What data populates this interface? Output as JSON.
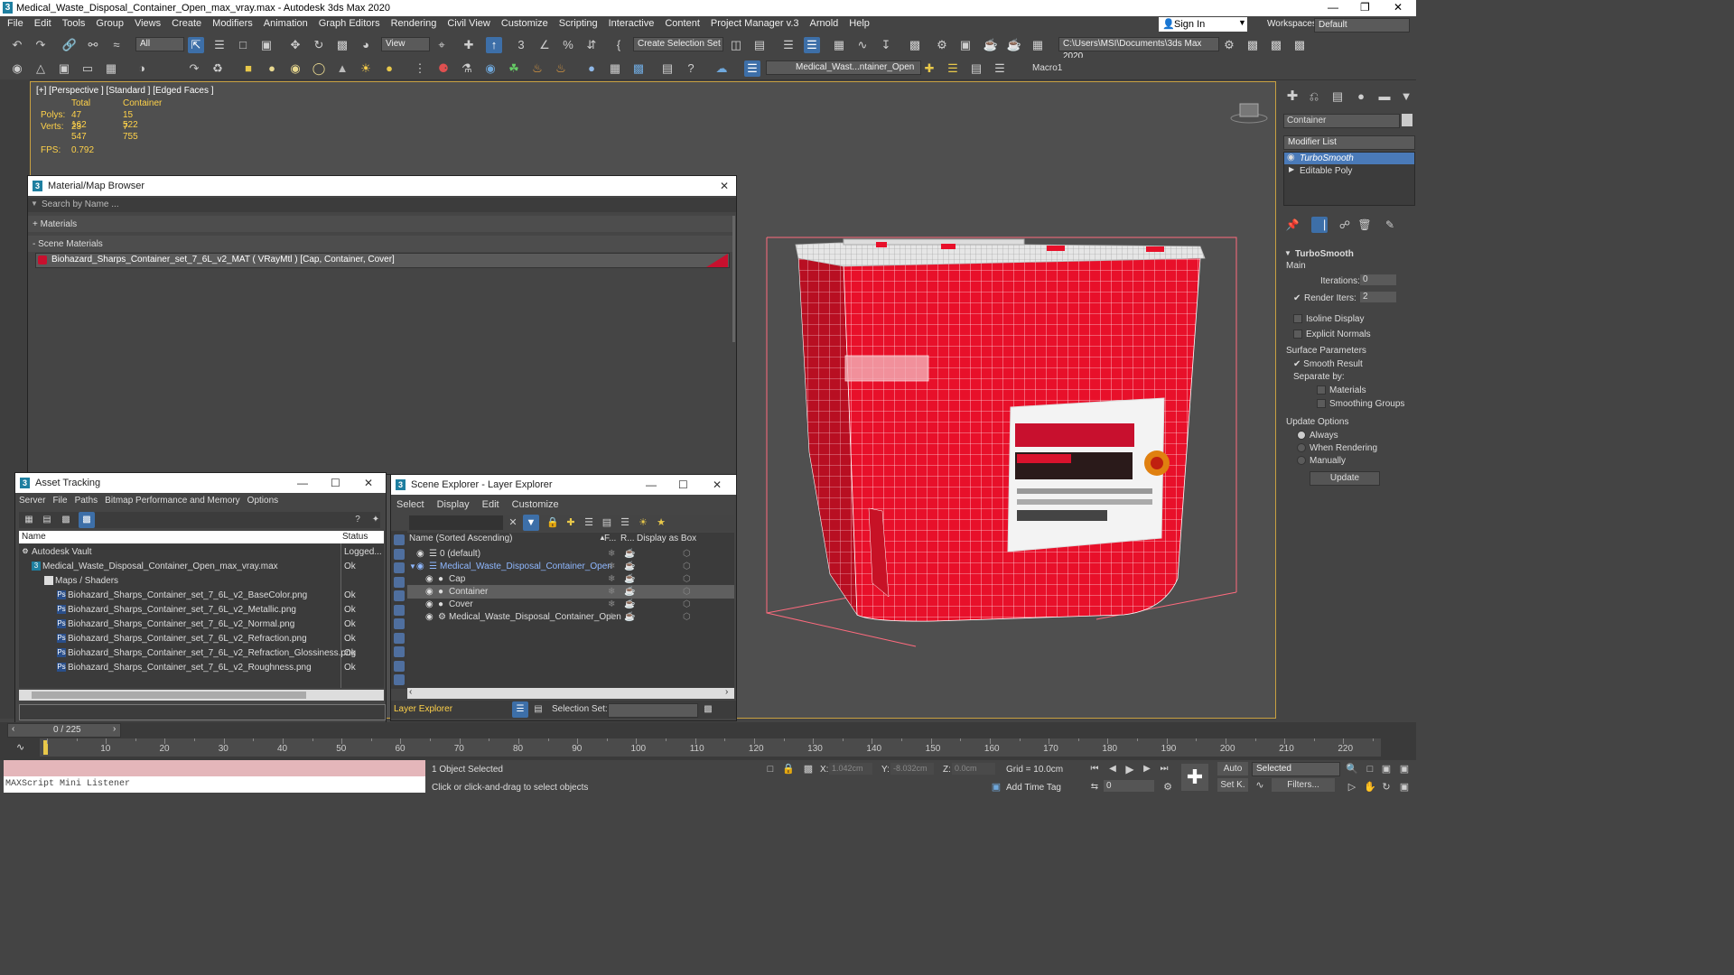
{
  "window": {
    "title": "Medical_Waste_Disposal_Container_Open_max_vray.max - Autodesk 3ds Max 2020"
  },
  "menu": [
    "File",
    "Edit",
    "Tools",
    "Group",
    "Views",
    "Create",
    "Modifiers",
    "Animation",
    "Graph Editors",
    "Rendering",
    "Civil View",
    "Customize",
    "Scripting",
    "Interactive",
    "Content",
    "Project Manager v.3",
    "Arnold",
    "Help"
  ],
  "account": {
    "sign_in": "Sign In",
    "workspaces_label": "Workspaces:",
    "workspace": "Default"
  },
  "toolbar": {
    "filter": "All",
    "view": "View",
    "selection_set": "Create Selection Set",
    "path": "C:\\Users\\MSI\\Documents\\3ds Max 2020",
    "layer": "Medical_Wast...ntainer_Open",
    "macro": "Macro1"
  },
  "viewport": {
    "label": "[+] [Perspective ] [Standard ] [Edged Faces ]",
    "stats": {
      "col_total": "Total",
      "col_container": "Container",
      "polys_label": "Polys:",
      "polys_total": "47 162",
      "polys_container": "15 522",
      "verts_label": "Verts:",
      "verts_total": "23 547",
      "verts_container": "7 755",
      "fps_label": "FPS:",
      "fps": "0.792"
    }
  },
  "material_browser": {
    "title": "Material/Map Browser",
    "search_placeholder": "Search by Name ...",
    "materials_group": "+ Materials",
    "scene_group": "- Scene Materials",
    "item": "Biohazard_Sharps_Container_set_7_6L_v2_MAT  ( VRayMtl )  [Cap, Container, Cover]"
  },
  "asset_tracking": {
    "title": "Asset Tracking",
    "menu": [
      "Server",
      "File",
      "Paths",
      "Bitmap Performance and Memory",
      "Options"
    ],
    "col_name": "Name",
    "col_status": "Status",
    "rows": [
      {
        "name": "Autodesk Vault",
        "status": "Logged..."
      },
      {
        "name": "Medical_Waste_Disposal_Container_Open_max_vray.max",
        "status": "Ok"
      },
      {
        "name": "Maps / Shaders",
        "status": ""
      },
      {
        "name": "Biohazard_Sharps_Container_set_7_6L_v2_BaseColor.png",
        "status": "Ok"
      },
      {
        "name": "Biohazard_Sharps_Container_set_7_6L_v2_Metallic.png",
        "status": "Ok"
      },
      {
        "name": "Biohazard_Sharps_Container_set_7_6L_v2_Normal.png",
        "status": "Ok"
      },
      {
        "name": "Biohazard_Sharps_Container_set_7_6L_v2_Refraction.png",
        "status": "Ok"
      },
      {
        "name": "Biohazard_Sharps_Container_set_7_6L_v2_Refraction_Glossiness.png",
        "status": "Ok"
      },
      {
        "name": "Biohazard_Sharps_Container_set_7_6L_v2_Roughness.png",
        "status": "Ok"
      }
    ]
  },
  "scene_explorer": {
    "title": "Scene Explorer - Layer Explorer",
    "menu": [
      "Select",
      "Display",
      "Edit",
      "Customize"
    ],
    "col_name": "Name (Sorted Ascending)",
    "col_f": "F...",
    "col_r": "R...",
    "col_box": "Display as Box",
    "rows": [
      {
        "name": "0 (default)"
      },
      {
        "name": "Medical_Waste_Disposal_Container_Open"
      },
      {
        "name": "Cap"
      },
      {
        "name": "Container"
      },
      {
        "name": "Cover"
      },
      {
        "name": "Medical_Waste_Disposal_Container_Open"
      }
    ],
    "footer_label": "Layer Explorer",
    "selection_set_label": "Selection Set:"
  },
  "command_panel": {
    "object_name": "Container",
    "modifier_list": "Modifier List",
    "stack": [
      "TurboSmooth",
      "Editable Poly"
    ],
    "rollout_title": "TurboSmooth",
    "main": "Main",
    "iterations_label": "Iterations:",
    "iterations": "0",
    "render_iters_label": "Render Iters:",
    "render_iters": "2",
    "isoline": "Isoline Display",
    "explicit": "Explicit Normals",
    "surface": "Surface Parameters",
    "smooth_result": "Smooth Result",
    "separate": "Separate by:",
    "sep_materials": "Materials",
    "sep_smoothing": "Smoothing Groups",
    "update_options": "Update Options",
    "always": "Always",
    "when_rendering": "When Rendering",
    "manually": "Manually",
    "update_btn": "Update"
  },
  "timeline": {
    "frame": "0 / 225",
    "ticks": [
      "10",
      "20",
      "30",
      "40",
      "50",
      "60",
      "70",
      "80",
      "90",
      "100",
      "110",
      "120",
      "130",
      "140",
      "150",
      "160",
      "170",
      "180",
      "190",
      "200",
      "210",
      "220"
    ]
  },
  "status": {
    "listener": "MAXScript Mini Listener",
    "selected": "1 Object Selected",
    "prompt": "Click or click-and-drag to select objects",
    "x_label": "X:",
    "x": "1.042cm",
    "y_label": "Y:",
    "y": "-8.032cm",
    "z_label": "Z:",
    "z": "0.0cm",
    "grid": "Grid = 10.0cm",
    "add_time_tag": "Add Time Tag",
    "auto": "Auto",
    "selected_dd": "Selected",
    "set_key": "Set K.",
    "filters": "Filters...",
    "frame_input": "0"
  }
}
